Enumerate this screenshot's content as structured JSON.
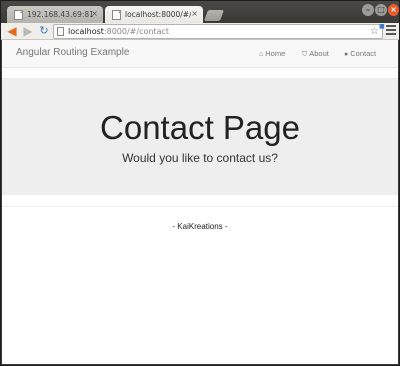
{
  "browser": {
    "tabs": [
      {
        "label": "192.168.43.69:8100",
        "active": false
      },
      {
        "label": "localhost:8000/#/con",
        "active": true
      }
    ],
    "tab_close_glyph": "×",
    "address": {
      "host": "localhost",
      "path": ":8000/#/contact"
    },
    "icons": {
      "back": "back-arrow-icon",
      "forward": "forward-arrow-icon",
      "reload": "reload-icon",
      "bookmark": "star-icon",
      "menu": "hamburger-menu-icon"
    },
    "accent_colors": {
      "back_arrow": "#e56a1d",
      "reload": "#3c7cc7",
      "close_button": "#e95b2c"
    }
  },
  "navbar": {
    "brand": "Angular Routing Example",
    "links": [
      {
        "label": "Home",
        "icon": "home-icon"
      },
      {
        "label": "About",
        "icon": "shield-icon"
      },
      {
        "label": "Contact",
        "icon": "comment-icon"
      }
    ]
  },
  "jumbotron": {
    "title": "Contact Page",
    "subtitle": "Would you like to contact us?"
  },
  "footer": {
    "text": "- KaiKreations -"
  }
}
